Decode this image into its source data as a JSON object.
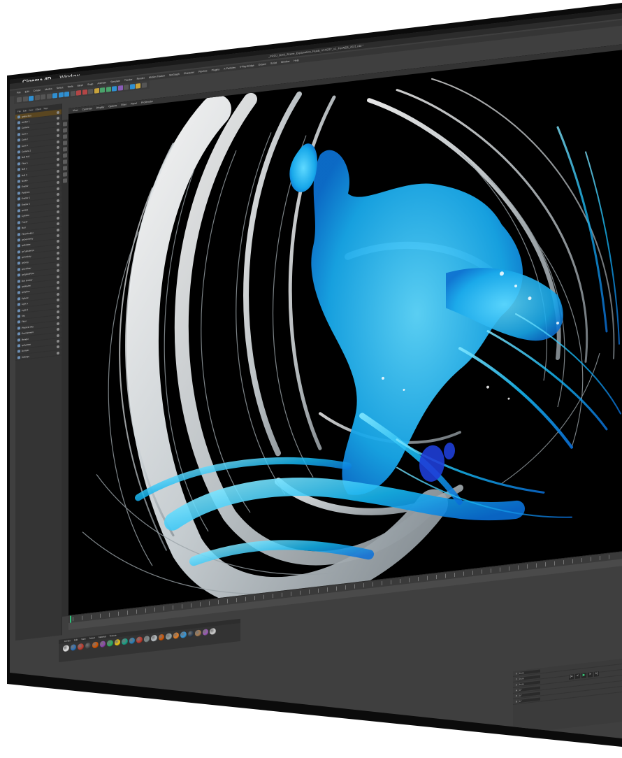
{
  "mac_menubar": {
    "app_name": "Cinema 4D",
    "items": [
      "Window"
    ]
  },
  "window_title": "_PROJ_0043_Scene_Explanation_Fluids_V1TEST_v1_ForWEB_2021.c4d *",
  "c4d_menu": [
    "File",
    "Edit",
    "Create",
    "Modes",
    "Select",
    "Tools",
    "Mesh",
    "Snap",
    "Animate",
    "Simulate",
    "Tracker",
    "Render",
    "Motion Tracker",
    "MoGraph",
    "Character",
    "Pipeline",
    "Plugins",
    "X-Particles",
    "V-Ray Bridge",
    "Octane",
    "Script",
    "Window",
    "Help"
  ],
  "object_manager": {
    "tabs": [
      "File",
      "Edit",
      "View",
      "Object",
      "Tags",
      "Bookmarks"
    ],
    "objects": [
      "spline Exit",
      "emitter 1",
      "Camera",
      "Cam 1",
      "Cam 2",
      "Cam 3",
      "Camera 2",
      "Null Null",
      "Flow 1",
      "Null 2",
      "Null 3",
      "Nodes",
      "Emitter",
      "Particles",
      "Emitter 1",
      "Emitter 2",
      "sphere",
      "Cylinder",
      "Tracer",
      "fluid",
      "Fluid Emitter",
      "xpGeometry",
      "xpEmitter",
      "xpTurbulence",
      "xpVorticity",
      "xpDrag",
      "xpCollider",
      "xpSplineFlow",
      "Box Emitter",
      "xpMesher",
      "xpSpline",
      "Sphere",
      "Light 1",
      "Light 2",
      "Sky",
      "Floor",
      "Physical Sky",
      "Environment",
      "Render",
      "xpSystem",
      "Domain",
      "Settings"
    ],
    "selected_index": 0
  },
  "viewport_menu": [
    "View",
    "Cameras",
    "Display",
    "Options",
    "Filter",
    "Panel",
    "ProRender"
  ],
  "materials": {
    "menu": [
      "Create",
      "Edit",
      "View",
      "Select",
      "Material",
      "Texture"
    ],
    "colors": [
      "#e8e8e8",
      "#2b6fb8",
      "#c0392b",
      "#444",
      "#d35400",
      "#8e44ad",
      "#27ae60",
      "#f1c40f",
      "#16a085",
      "#2980b9",
      "#c0392b",
      "#7f8c8d",
      "#bdc3c7",
      "#d35400",
      "#95a5a6",
      "#e67e22",
      "#3498db",
      "#2c3e50",
      "#a67c52",
      "#9b59b6",
      "#d4d4d4"
    ]
  },
  "attributes": {
    "rows": [
      {
        "label": "X",
        "value": "0 cm"
      },
      {
        "label": "Y",
        "value": "0 cm"
      },
      {
        "label": "Z",
        "value": "0 cm"
      },
      {
        "label": "H",
        "value": "0 °"
      },
      {
        "label": "P",
        "value": "0 °"
      },
      {
        "label": "B",
        "value": "0 °"
      }
    ]
  },
  "timeline": {
    "current_frame": "0",
    "end_frame": "800 F"
  },
  "transport": {
    "buttons": [
      "|<",
      "<",
      "▶",
      ">",
      ">|"
    ]
  }
}
